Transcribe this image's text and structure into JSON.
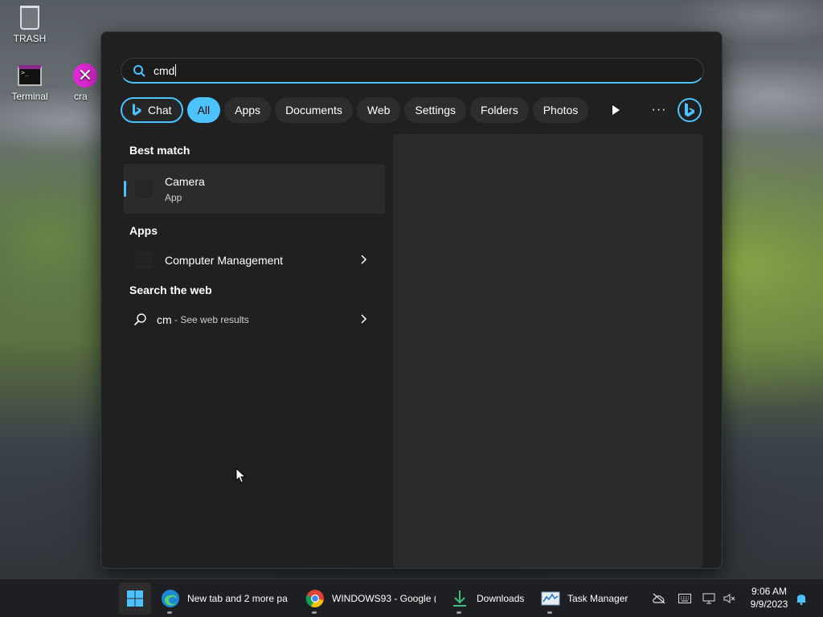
{
  "desktop": {
    "icons": [
      {
        "label": "TRASH"
      },
      {
        "label": "Terminal"
      },
      {
        "label": "cra"
      }
    ]
  },
  "search": {
    "query": "cmd",
    "icon": "search-icon"
  },
  "filters": {
    "chat_label": "Chat",
    "items": [
      "All",
      "Apps",
      "Documents",
      "Web",
      "Settings",
      "Folders",
      "Photos"
    ],
    "selected": "All",
    "accent_color": "#4cc2ff"
  },
  "toolbar": {
    "play_icon": "play-icon",
    "more_icon": "more-icon",
    "more_label": "···",
    "bing_icon": "bing-icon"
  },
  "results": {
    "best_match_heading": "Best match",
    "best_match": {
      "title": "Camera",
      "subtitle": "App"
    },
    "apps_heading": "Apps",
    "apps": [
      {
        "title": "Computer Management"
      }
    ],
    "web_heading": "Search the web",
    "web": {
      "query": "cm",
      "suffix": " - See web results"
    }
  },
  "taskbar": {
    "apps": [
      {
        "label": "New tab and 2 more pa",
        "icon": "edge-icon"
      },
      {
        "label": "WINDOWS93 - Google (",
        "icon": "chrome-icon"
      },
      {
        "label": "Downloads",
        "icon": "download-icon"
      },
      {
        "label": "Task Manager",
        "icon": "task-manager-icon"
      }
    ],
    "clock": {
      "time": "9:06 AM",
      "date": "9/9/2023"
    }
  }
}
